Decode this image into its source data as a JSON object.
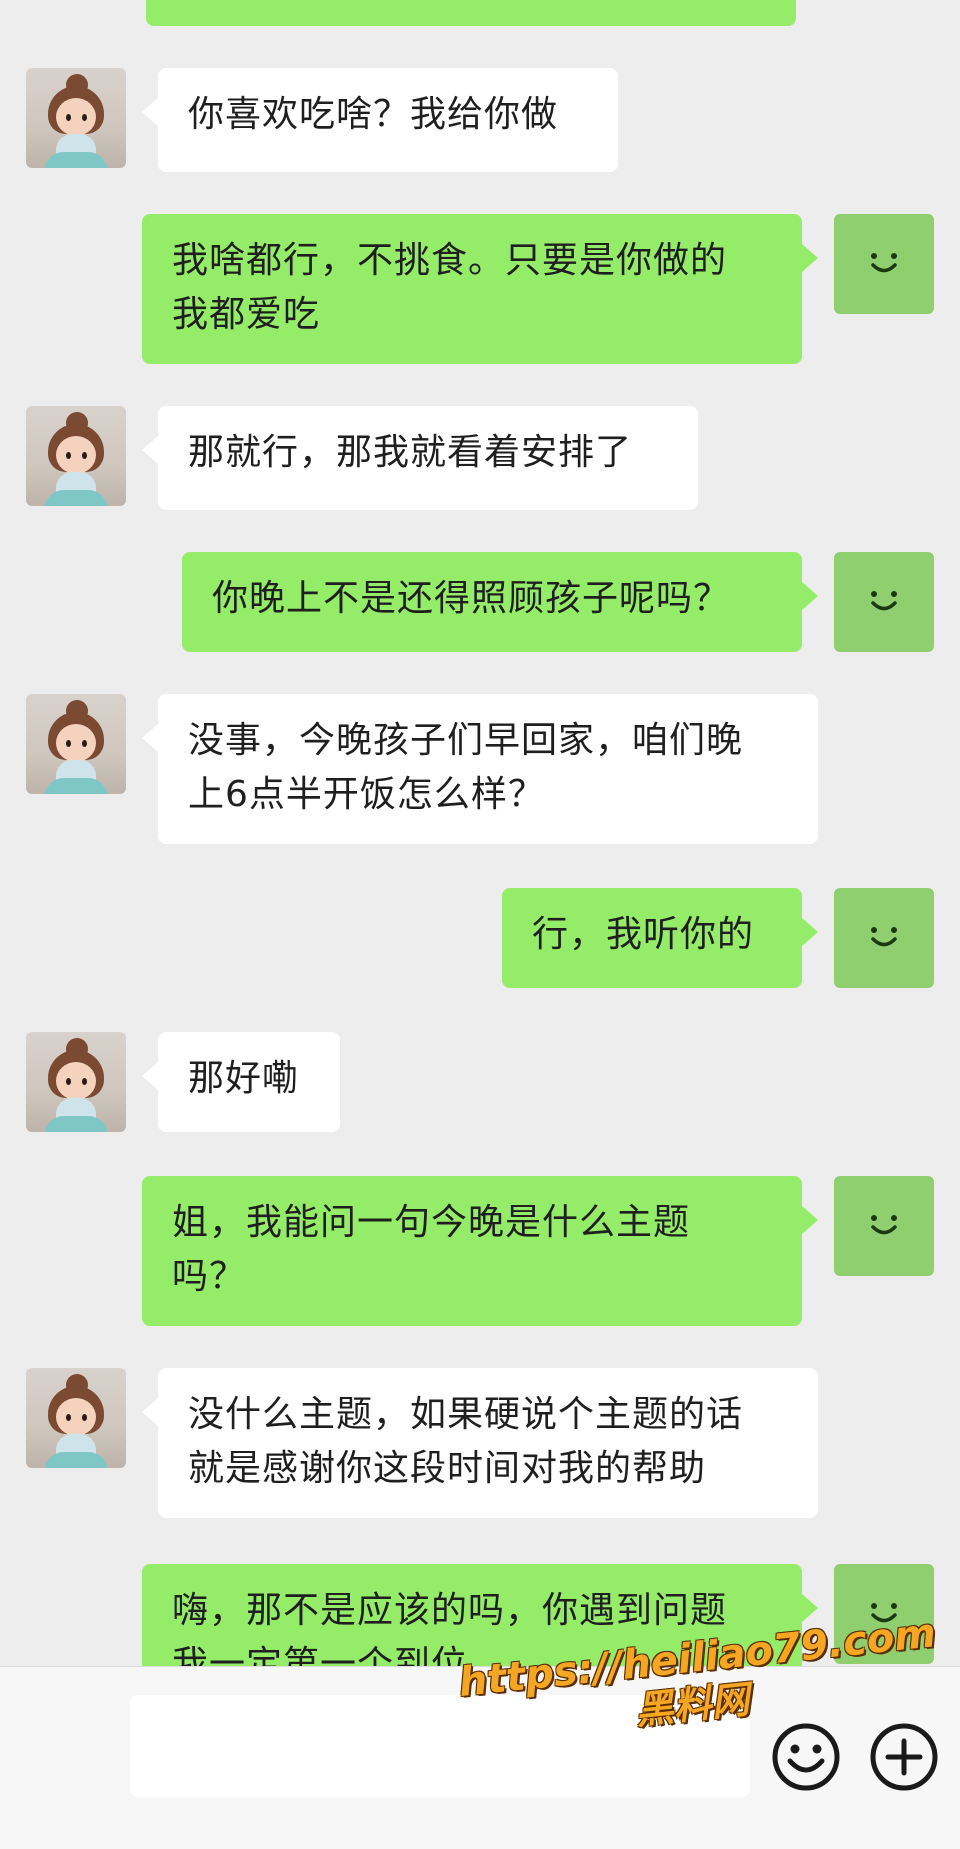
{
  "messages": [
    {
      "side": "in",
      "text": "你喜欢吃啥？我给你做"
    },
    {
      "side": "out",
      "text": "我啥都行，不挑食。只要是你做的\n我都爱吃"
    },
    {
      "side": "in",
      "text": "那就行，那我就看着安排了"
    },
    {
      "side": "out",
      "text": "你晚上不是还得照顾孩子呢吗？"
    },
    {
      "side": "in",
      "text": "没事，今晚孩子们早回家，咱们晚\n上6点半开饭怎么样？"
    },
    {
      "side": "out",
      "text": "行，我听你的"
    },
    {
      "side": "in",
      "text": "那好嘞"
    },
    {
      "side": "out",
      "text": "姐，我能问一句今晚是什么主题\n吗？"
    },
    {
      "side": "in",
      "text": "没什么主题，如果硬说个主题的话\n就是感谢你这段时间对我的帮助"
    },
    {
      "side": "out",
      "text": "嗨，那不是应该的吗，你遇到问题\n我一定第一个到位"
    }
  ],
  "watermark": {
    "url": "https://heiliao79.com",
    "name": "黑料网"
  },
  "icons": {
    "emoji": "emoji-icon",
    "plus": "plus-icon",
    "self_avatar": "smile-avatar-icon"
  },
  "colors": {
    "out_bubble": "#95ec69",
    "in_bubble": "#ffffff",
    "background": "#ededed"
  }
}
